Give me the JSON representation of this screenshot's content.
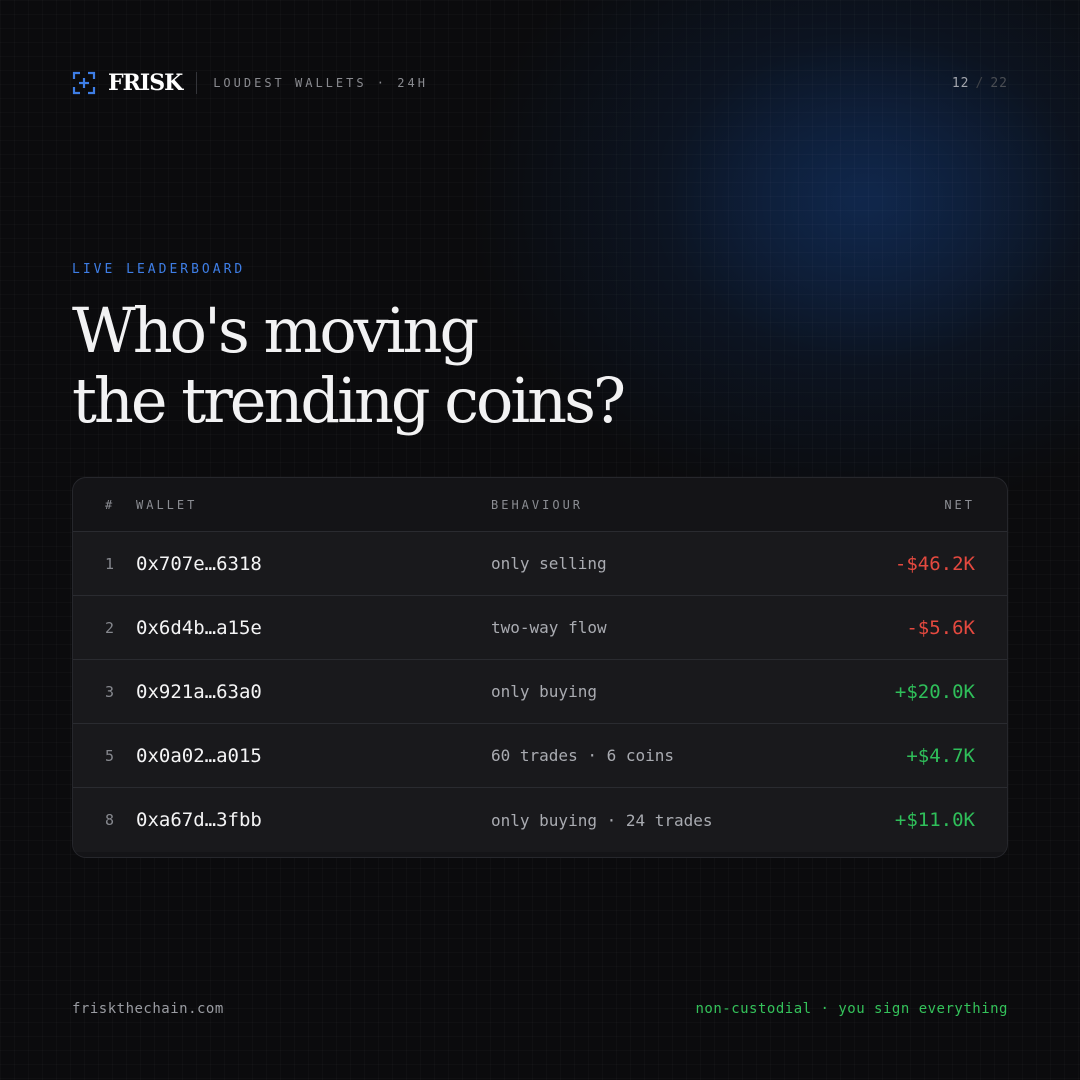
{
  "header": {
    "logo_icon": "bracket-plus-icon",
    "brand": "FRISK",
    "subtitle": "LOUDEST WALLETS · 24H",
    "page_current": "12",
    "page_separator": "/",
    "page_total": "22"
  },
  "hero": {
    "eyebrow": "LIVE LEADERBOARD",
    "title_line1": "Who's moving",
    "title_line2": "the trending coins?"
  },
  "table": {
    "columns": {
      "rank": "#",
      "wallet": "WALLET",
      "behaviour": "BEHAVIOUR",
      "net": "NET"
    },
    "rows": [
      {
        "rank": "1",
        "wallet": "0x707e…6318",
        "behaviour": "only selling",
        "net": "-$46.2K",
        "direction": "negative"
      },
      {
        "rank": "2",
        "wallet": "0x6d4b…a15e",
        "behaviour": "two-way flow",
        "net": "-$5.6K",
        "direction": "negative"
      },
      {
        "rank": "3",
        "wallet": "0x921a…63a0",
        "behaviour": "only buying",
        "net": "+$20.0K",
        "direction": "positive"
      },
      {
        "rank": "5",
        "wallet": "0x0a02…a015",
        "behaviour": "60 trades · 6 coins",
        "net": "+$4.7K",
        "direction": "positive"
      },
      {
        "rank": "8",
        "wallet": "0xa67d…3fbb",
        "behaviour": "only buying · 24 trades",
        "net": "+$11.0K",
        "direction": "positive"
      }
    ]
  },
  "footer": {
    "site": "friskthechain.com",
    "tagline": "non-custodial · you sign everything"
  },
  "colors": {
    "background": "#0b0b0d",
    "accent_blue": "#3e7ee6",
    "negative": "#e5493f",
    "positive": "#2fbf5a"
  }
}
